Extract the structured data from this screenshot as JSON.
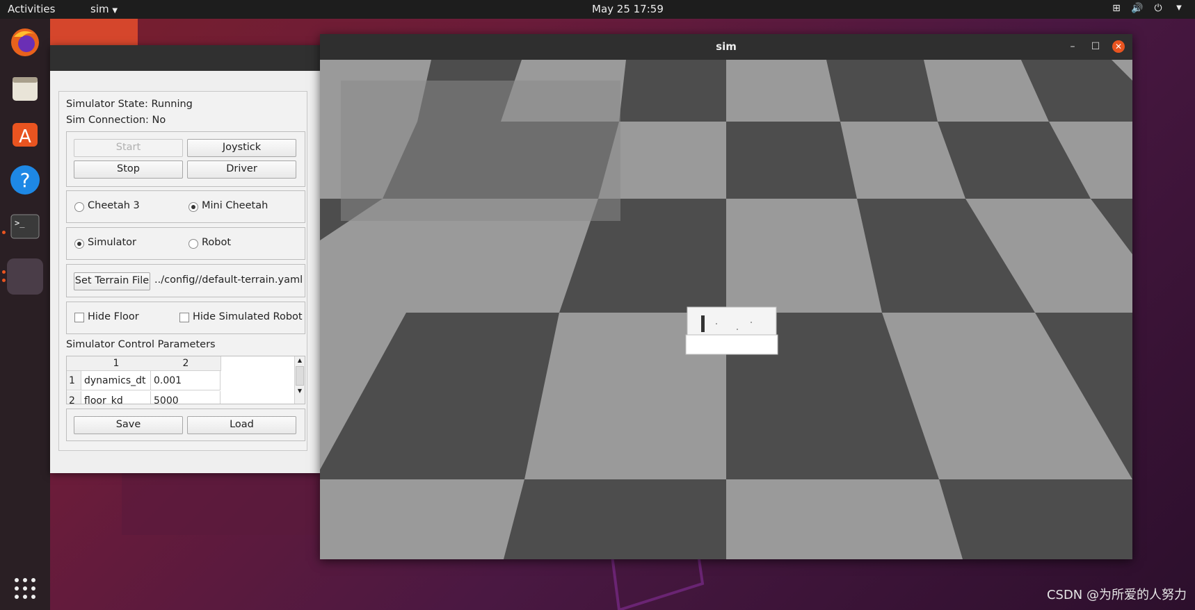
{
  "topbar": {
    "activities": "Activities",
    "app_menu": "sim",
    "clock": "May 25  17:59"
  },
  "dock": {
    "items": [
      "firefox-icon",
      "files-icon",
      "software-icon",
      "help-icon",
      "terminal-icon",
      "sim-app-icon",
      "show-apps-icon"
    ]
  },
  "panel": {
    "simulator_state": "Simulator State: Running",
    "sim_connection": "Sim Connection: No",
    "buttons": {
      "start": "Start",
      "joystick": "Joystick",
      "stop": "Stop",
      "driver": "Driver",
      "set_terrain": "Set Terrain File",
      "save": "Save",
      "load": "Load"
    },
    "robot_type": {
      "option1": "Cheetah 3",
      "option2": "Mini Cheetah",
      "selected": "Mini Cheetah"
    },
    "mode": {
      "option1": "Simulator",
      "option2": "Robot",
      "selected": "Simulator"
    },
    "terrain_file": "../config//default-terrain.yaml",
    "hide_floor": "Hide Floor",
    "hide_robot": "Hide Simulated Robot",
    "params_title": "Simulator Control Parameters",
    "table": {
      "headers": [
        "1",
        "2"
      ],
      "rows": [
        {
          "index": "1",
          "name": "dynamics_dt",
          "value": "0.001"
        },
        {
          "index": "2",
          "name": "floor_kd",
          "value": "5000"
        }
      ]
    }
  },
  "sim_window": {
    "title": "sim",
    "floor_colors": {
      "light": "#9a9a9a",
      "dark": "#4d4d4d"
    }
  },
  "watermark": "CSDN @为所爱的人努力"
}
